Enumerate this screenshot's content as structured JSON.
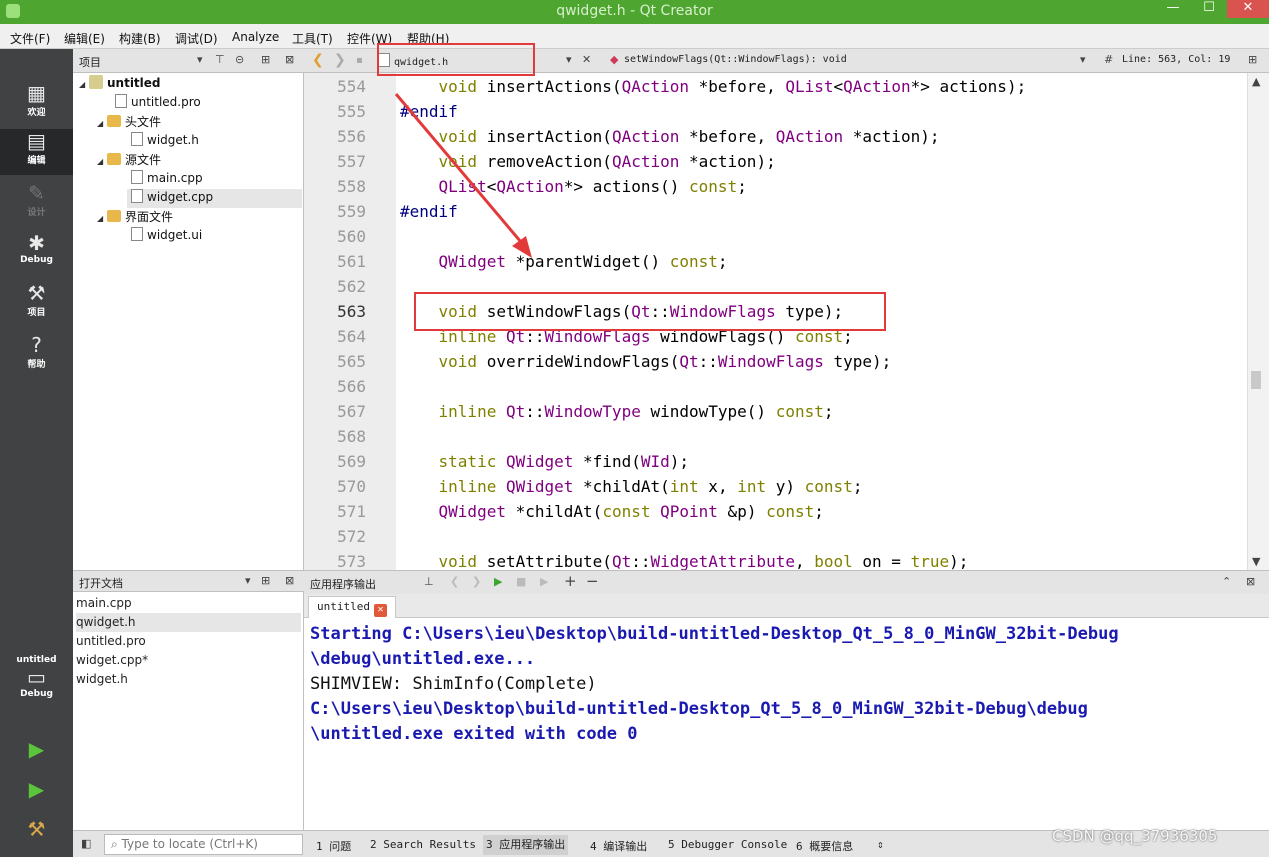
{
  "window": {
    "title": "qwidget.h - Qt Creator",
    "minimize": "—",
    "maximize": "☐",
    "close": "✕"
  },
  "menu": [
    "文件(F)",
    "编辑(E)",
    "构建(B)",
    "调试(D)",
    "Analyze",
    "工具(T)",
    "控件(W)",
    "帮助(H)"
  ],
  "modes": [
    {
      "label": "欢迎",
      "icon": "grid-icon"
    },
    {
      "label": "编辑",
      "icon": "edit-icon"
    },
    {
      "label": "设计",
      "icon": "pen-icon"
    },
    {
      "label": "Debug",
      "icon": "bug-icon"
    },
    {
      "label": "项目",
      "icon": "wrench-icon"
    },
    {
      "label": "帮助",
      "icon": "help-icon"
    }
  ],
  "kit": {
    "name": "untitled",
    "mode": "Debug"
  },
  "project_panel": {
    "title": "项目",
    "tree": [
      {
        "label": "untitled",
        "type": "project",
        "expanded": true
      },
      {
        "label": "untitled.pro",
        "type": "file"
      },
      {
        "label": "头文件",
        "type": "folder",
        "expanded": true
      },
      {
        "label": "widget.h",
        "type": "file"
      },
      {
        "label": "源文件",
        "type": "folder",
        "expanded": true
      },
      {
        "label": "main.cpp",
        "type": "file"
      },
      {
        "label": "widget.cpp",
        "type": "file",
        "selected": true
      },
      {
        "label": "界面文件",
        "type": "folder",
        "expanded": true
      },
      {
        "label": "widget.ui",
        "type": "file"
      }
    ]
  },
  "open_docs": {
    "title": "打开文档",
    "items": [
      "main.cpp",
      "qwidget.h",
      "untitled.pro",
      "widget.cpp*",
      "widget.h"
    ]
  },
  "editor": {
    "file": "qwidget.h",
    "symbol": "setWindowFlags(Qt::WindowFlags): void",
    "position": "Line: 563, Col: 19",
    "current_line": "563",
    "lines": [
      {
        "n": "554",
        "text": "    void insertActions(QAction *before, QList<QAction*> actions);"
      },
      {
        "n": "555",
        "text": "#endif"
      },
      {
        "n": "556",
        "text": "    void insertAction(QAction *before, QAction *action);"
      },
      {
        "n": "557",
        "text": "    void removeAction(QAction *action);"
      },
      {
        "n": "558",
        "text": "    QList<QAction*> actions() const;"
      },
      {
        "n": "559",
        "text": "#endif"
      },
      {
        "n": "560",
        "text": ""
      },
      {
        "n": "561",
        "text": "    QWidget *parentWidget() const;"
      },
      {
        "n": "562",
        "text": ""
      },
      {
        "n": "563",
        "text": "    void setWindowFlags(Qt::WindowFlags type);"
      },
      {
        "n": "564",
        "text": "    inline Qt::WindowFlags windowFlags() const;"
      },
      {
        "n": "565",
        "text": "    void overrideWindowFlags(Qt::WindowFlags type);"
      },
      {
        "n": "566",
        "text": ""
      },
      {
        "n": "567",
        "text": "    inline Qt::WindowType windowType() const;"
      },
      {
        "n": "568",
        "text": ""
      },
      {
        "n": "569",
        "text": "    static QWidget *find(WId);"
      },
      {
        "n": "570",
        "text": "    inline QWidget *childAt(int x, int y) const;"
      },
      {
        "n": "571",
        "text": "    QWidget *childAt(const QPoint &p) const;"
      },
      {
        "n": "572",
        "text": ""
      },
      {
        "n": "573",
        "text": "    void setAttribute(Qt::WidgetAttribute, bool on = true);"
      }
    ]
  },
  "output_pane": {
    "title": "应用程序输出",
    "tab": "untitled",
    "lines": [
      {
        "text": "Starting C:\\Users\\ieu\\Desktop\\build-untitled-Desktop_Qt_5_8_0_MinGW_32bit-Debug",
        "style": "blue"
      },
      {
        "text": "\\debug\\untitled.exe...",
        "style": "blue"
      },
      {
        "text": "SHIMVIEW: ShimInfo(Complete)",
        "style": "plain"
      },
      {
        "text": "C:\\Users\\ieu\\Desktop\\build-untitled-Desktop_Qt_5_8_0_MinGW_32bit-Debug\\debug",
        "style": "blue"
      },
      {
        "text": "\\untitled.exe exited with code 0",
        "style": "blue"
      }
    ]
  },
  "statusbar": {
    "locator_placeholder": "Type to locate (Ctrl+K)",
    "panes": [
      "1 问题",
      "2 Search Results",
      "3 应用程序输出",
      "4 编译输出",
      "5 Debugger Console",
      "6 概要信息"
    ],
    "active_pane": 2
  },
  "watermark": "CSDN @qq_37936305",
  "colors": {
    "titlebar": "#4ea52f",
    "annotation": "#e23a3a",
    "keyword": "#808000",
    "type": "#800080"
  }
}
